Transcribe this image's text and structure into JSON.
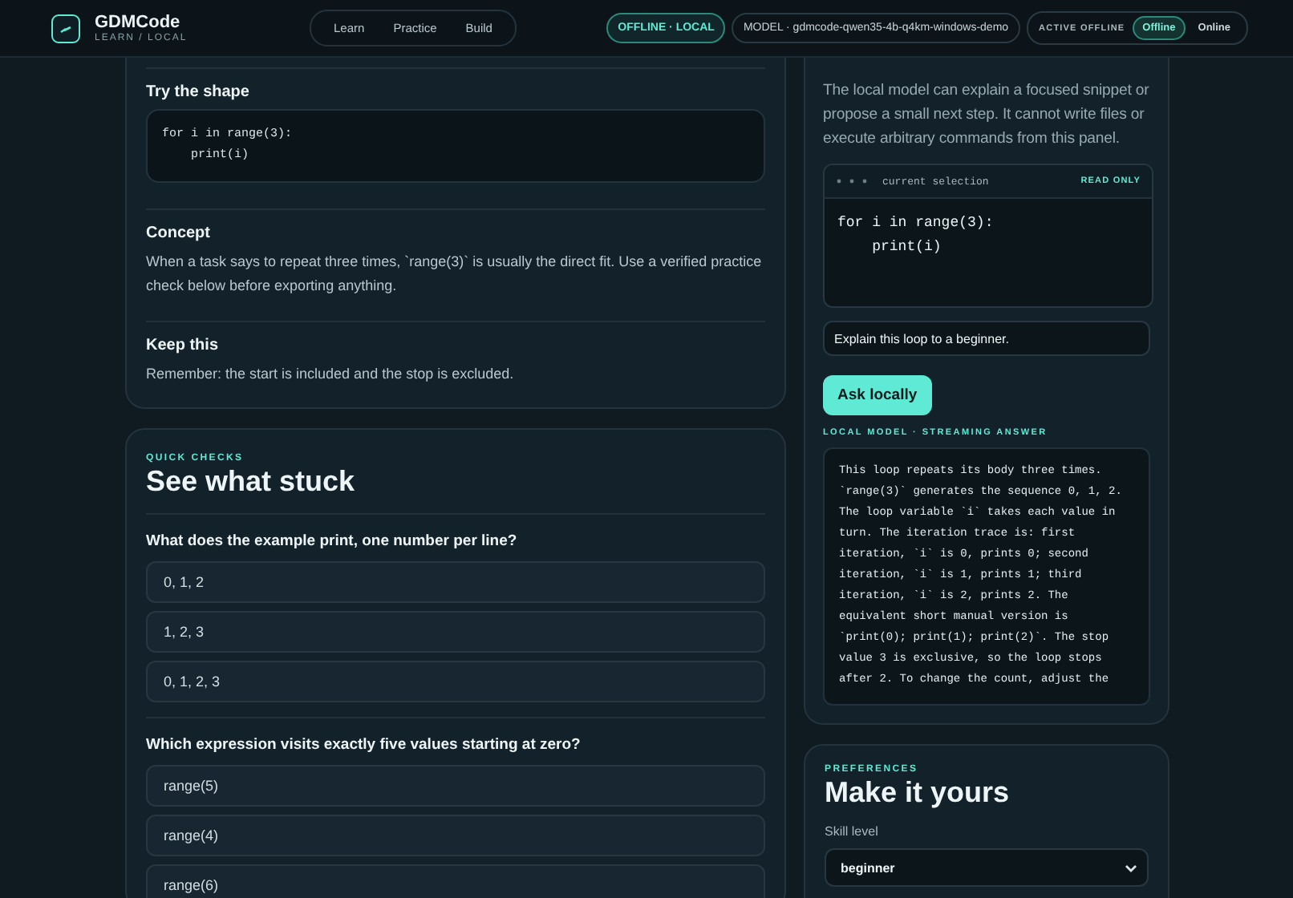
{
  "header": {
    "title": "GDMCode",
    "subtitle": "LEARN / LOCAL",
    "nav": [
      {
        "label": "Learn",
        "selected": false
      },
      {
        "label": "Practice",
        "selected": false
      },
      {
        "label": "Build",
        "selected": false
      }
    ],
    "status": "OFFLINE · LOCAL",
    "model": "MODEL · gdmcode-qwen35-4b-q4km-windows-demo",
    "mode_label": "ACTIVE OFFLINE",
    "modes": [
      {
        "label": "Offline",
        "selected": true
      },
      {
        "label": "Online",
        "selected": false
      }
    ]
  },
  "lesson": {
    "sections": [
      {
        "kind": "code",
        "heading": "Try the shape",
        "code": "for i in range(3):\n    print(i)"
      },
      {
        "kind": "text",
        "heading": "Concept",
        "text": "When a task says to repeat three times, `range(3)` is usually the direct fit. Use a verified practice check below before exporting anything."
      },
      {
        "kind": "text",
        "heading": "Keep this",
        "text": "Remember: the start is included and the stop is excluded."
      }
    ]
  },
  "quick_checks": {
    "eyebrow": "QUICK CHECKS",
    "title": "See what stuck",
    "questions": [
      {
        "prompt": "What does the example print, one number per line?",
        "options": [
          "0, 1, 2",
          "1, 2, 3",
          "0, 1, 2, 3"
        ]
      },
      {
        "prompt": "Which expression visits exactly five values starting at zero?",
        "options": [
          "range(5)",
          "range(4)",
          "range(6)"
        ]
      }
    ]
  },
  "assistant": {
    "intro": "The local model can explain a focused snippet or propose a small next step. It cannot write files or execute arbitrary commands from this panel.",
    "selection": {
      "label": "current selection",
      "badge": "READ ONLY",
      "code": "for i in range(3):\n    print(i)"
    },
    "prompt_value": "Explain this loop to a beginner.",
    "ask_button": "Ask locally",
    "answer_label": "LOCAL MODEL · STREAMING ANSWER",
    "answer": "This loop repeats its body three times. `range(3)` generates the sequence 0, 1, 2. The loop variable `i` takes each value in turn. The iteration trace is: first iteration, `i` is 0, prints 0; second iteration, `i` is 1, prints 1; third iteration, `i` is 2, prints 2. The equivalent short manual version is `print(0); print(1); print(2)`. The stop value 3 is exclusive, so the loop stops after 2. To change the count, adjust the"
  },
  "preferences": {
    "eyebrow": "PREFERENCES",
    "title": "Make it yours",
    "skill_label": "Skill level",
    "skill_value": "beginner"
  }
}
